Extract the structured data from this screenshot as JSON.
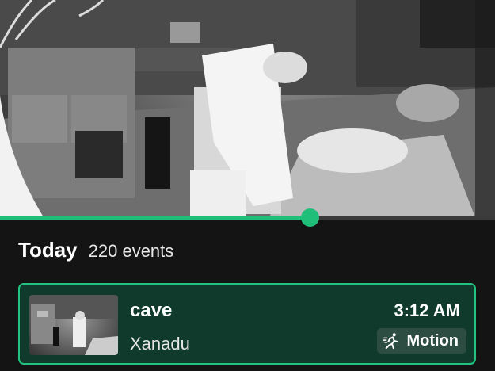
{
  "video": {
    "progress": 0.626
  },
  "timeline": {
    "title": "Today",
    "count": "220 events"
  },
  "event": {
    "camera": "cave",
    "location": "Xanadu",
    "time": "3:12 AM",
    "badge": {
      "label": "Motion",
      "icon": "running-person-icon"
    }
  },
  "colors": {
    "accent": "#1fbf7a",
    "card_bg": "#0f3a2c",
    "card_border": "#21c47f",
    "badge_bg": "#2d4d42",
    "background": "#141414"
  }
}
